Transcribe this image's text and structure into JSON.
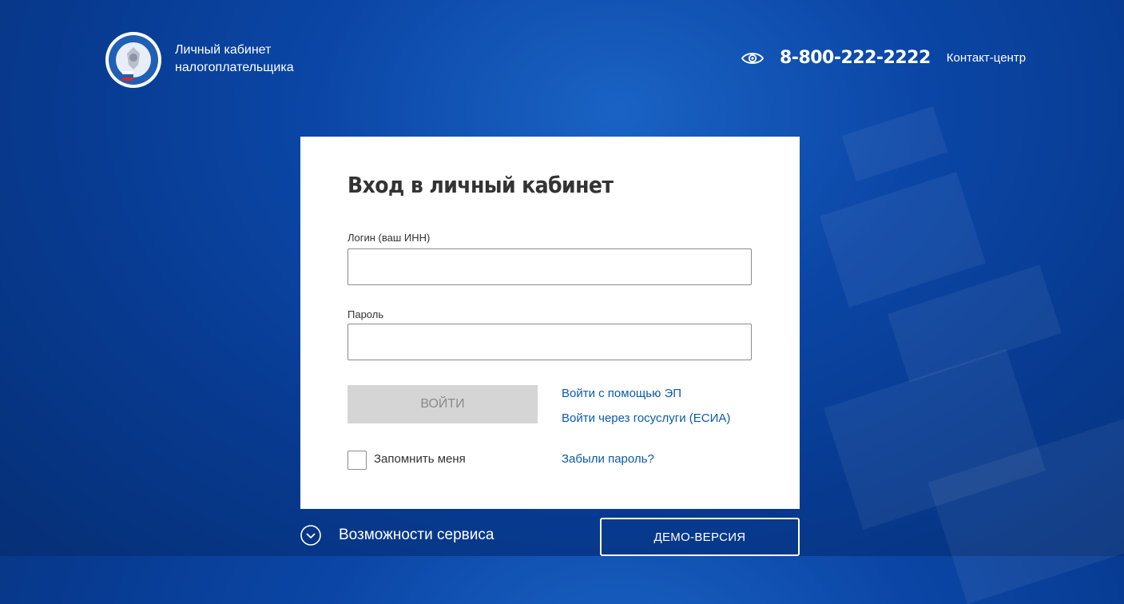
{
  "header": {
    "brand_line1": "Личный кабинет",
    "brand_line2": "налогоплательщика",
    "phone": "8-800-222-2222",
    "contact_center": "Контакт-центр"
  },
  "login": {
    "title": "Вход в личный кабинет",
    "login_label": "Логин (ваш ИНН)",
    "login_value": "",
    "password_label": "Пароль",
    "password_value": "",
    "submit_label": "ВОЙТИ",
    "ep_link": "Войти с помощью ЭП",
    "esia_link": "Войти через госуслуги (ЕСИА)",
    "remember_label": "Запомнить меня",
    "remember_checked": false,
    "forgot_link": "Забыли пароль?"
  },
  "footer": {
    "features_label": "Возможности сервиса",
    "demo_label": "ДЕМО-ВЕРСИЯ"
  },
  "colors": {
    "background": "#0b46a6",
    "link": "#0a5aad",
    "button_disabled": "#d5d5d5"
  },
  "icons": {
    "logo": "fns-emblem-icon",
    "accessibility": "eye-icon",
    "features": "chevron-down-circle-icon"
  }
}
